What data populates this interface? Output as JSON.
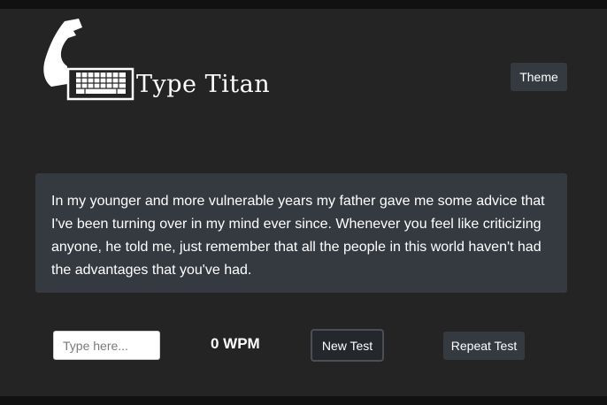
{
  "header": {
    "logo_icon": "muscle-arm-keyboard-icon",
    "title": "Type Titan",
    "theme_label": "Theme"
  },
  "passage": {
    "text": "In my younger and more vulnerable years my father gave me some advice that I've been turning over in my mind ever since. Whenever you feel like criticizing anyone, he told me, just remember that all the people in this world haven't had the advantages that you've had."
  },
  "controls": {
    "input_placeholder": "Type here...",
    "input_value": "",
    "wpm_text": "0 WPM",
    "new_test_label": "New Test",
    "repeat_test_label": "Repeat Test"
  },
  "colors": {
    "page_background": "#242424",
    "panel": "#353a41",
    "text": "#ffffff"
  }
}
